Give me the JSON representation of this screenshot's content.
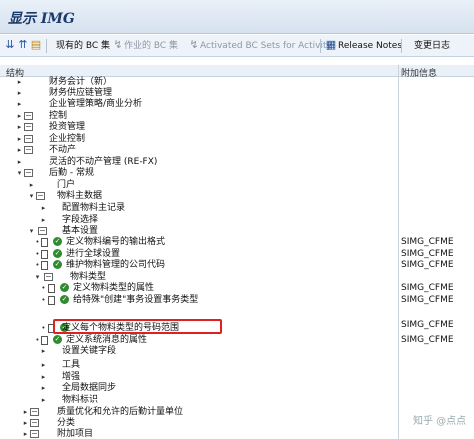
{
  "window": {
    "title": "显示 IMG"
  },
  "toolbar": {
    "existing_bc_sets": "现有的 BC 集",
    "activity_bc_sets": "作业的 BC 集",
    "activated_bc_sets": "Activated BC Sets for Activity",
    "release_notes": "Release Notes",
    "change_log": "变更日志"
  },
  "columns": {
    "structure": "结构",
    "additional_info": "附加信息"
  },
  "tree": [
    {
      "label": "财务会计（新）",
      "attr": ""
    },
    {
      "label": "财务供应链管理",
      "attr": ""
    },
    {
      "label": "企业管理策略/商业分析",
      "attr": ""
    },
    {
      "label": "控制",
      "attr": ""
    },
    {
      "label": "投资管理",
      "attr": ""
    },
    {
      "label": "企业控制",
      "attr": ""
    },
    {
      "label": "不动产",
      "attr": ""
    },
    {
      "label": "灵活的不动产管理 (RE-FX)",
      "attr": ""
    },
    {
      "label": "后勤 - 常规",
      "attr": ""
    },
    {
      "label": "门户",
      "attr": ""
    },
    {
      "label": "物料主数据",
      "attr": ""
    },
    {
      "label": "配置物料主记录",
      "attr": ""
    },
    {
      "label": "字段选择",
      "attr": ""
    },
    {
      "label": "基本设置",
      "attr": ""
    },
    {
      "label": "定义物料编号的输出格式",
      "attr": "SIMG_CFME"
    },
    {
      "label": "进行全球设置",
      "attr": "SIMG_CFME"
    },
    {
      "label": "维护物料管理的公司代码",
      "attr": "SIMG_CFME"
    },
    {
      "label": "物料类型",
      "attr": ""
    },
    {
      "label": "定义物料类型的属性",
      "attr": "SIMG_CFME"
    },
    {
      "label": "给特殊\"创建\"事务设置事务类型",
      "attr": "SIMG_CFME"
    },
    {
      "label": "定义每个物料类型的号码范围",
      "attr": "SIMG_CFME"
    },
    {
      "label": "定义系统消息的属性",
      "attr": "SIMG_CFME"
    },
    {
      "label": "设置关键字段",
      "attr": ""
    },
    {
      "label": "工具",
      "attr": ""
    },
    {
      "label": "增强",
      "attr": ""
    },
    {
      "label": "全局数据同步",
      "attr": ""
    },
    {
      "label": "物料标识",
      "attr": ""
    },
    {
      "label": "质量优化和允许的后勤计量单位",
      "attr": ""
    },
    {
      "label": "分类",
      "attr": ""
    },
    {
      "label": "附加项目",
      "attr": ""
    }
  ],
  "watermark": "知乎 @点点"
}
